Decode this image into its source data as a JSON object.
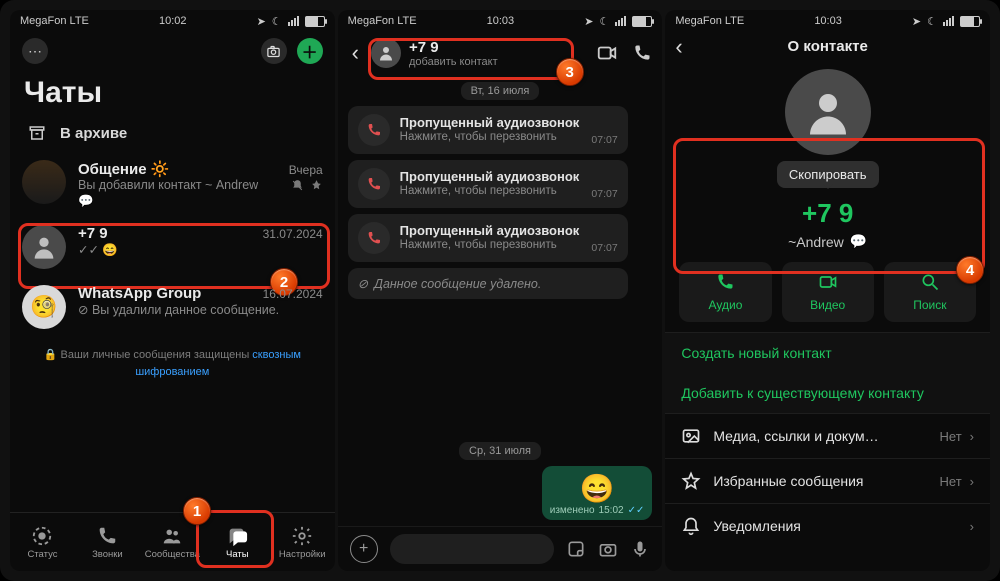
{
  "screen1": {
    "status": {
      "carrier": "MegaFon  LTE",
      "time": "10:02"
    },
    "title": "Чаты",
    "archive": "В архиве",
    "chats": [
      {
        "name": "Общение 🔆",
        "sub": "Вы добавили контакт ~ Andrew",
        "date": "Вчера"
      },
      {
        "name": "+7 9",
        "sub": "✓✓ 😄",
        "date": "31.07.2024"
      },
      {
        "name": "WhatsApp Group",
        "sub": "⊘ Вы удалили данное сообщение.",
        "date": "16.07.2024"
      }
    ],
    "encryption_prefix": "🔒 Ваши личные сообщения защищены ",
    "encryption_link": "сквозным шифрованием",
    "tabs": [
      "Статус",
      "Звонки",
      "Сообщества",
      "Чаты",
      "Настройки"
    ],
    "active_tab": 3
  },
  "screen2": {
    "status": {
      "carrier": "MegaFon  LTE",
      "time": "10:03"
    },
    "header": {
      "title": "+7 9",
      "subtitle": "добавить контакт"
    },
    "date1": "Вт, 16 июля",
    "missed": {
      "title": "Пропущенный аудиозвонок",
      "sub": "Нажмите, чтобы перезвонить"
    },
    "missed_times": [
      "07:07",
      "07:07",
      "07:07"
    ],
    "deleted": "Данное сообщение удалено.",
    "date2": "Ср, 31 июля",
    "out": {
      "emoji": "😄",
      "edited": "изменено",
      "time": "15:02"
    }
  },
  "screen3": {
    "status": {
      "carrier": "MegaFon  LTE",
      "time": "10:03"
    },
    "title": "О контакте",
    "copy": "Скопировать",
    "number": "+7 9",
    "name": "~Andrew",
    "actions": [
      "Аудио",
      "Видео",
      "Поиск"
    ],
    "link_new": "Создать новый контакт",
    "link_add": "Добавить к существующему контакту",
    "rows": [
      {
        "label": "Медиа, ссылки и докум…",
        "right": "Нет"
      },
      {
        "label": "Избранные сообщения",
        "right": "Нет"
      },
      {
        "label": "Уведомления",
        "right": ""
      }
    ]
  }
}
